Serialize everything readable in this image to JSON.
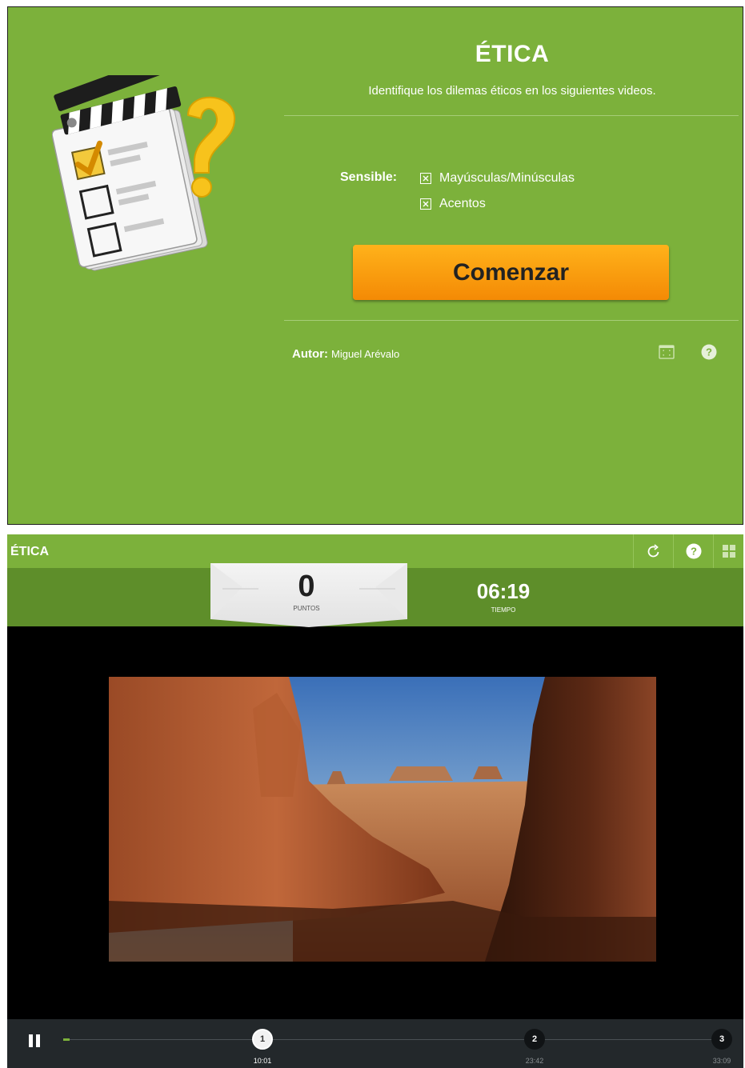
{
  "intro": {
    "title": "ÉTICA",
    "subtitle": "Identifique los dilemas éticos en los siguientes videos.",
    "sensible_label": "Sensible:",
    "options": [
      {
        "label": "Mayúsculas/Minúsculas",
        "checked": true
      },
      {
        "label": "Acentos",
        "checked": true
      }
    ],
    "start_button": "Comenzar",
    "author_label": "Autor:",
    "author_name": "Miguel Arévalo",
    "icons": [
      "quiz-clapperboard-illustration",
      "fullscreen-icon",
      "help-icon"
    ]
  },
  "game": {
    "title": "ÉTICA",
    "toolbar_icons": [
      "restart-icon",
      "help-icon",
      "grid-icon"
    ],
    "score": "0",
    "score_label": "PUNTOS",
    "time": "06:19",
    "time_label": "TIEMPO",
    "video": {
      "description": "desert canyon scene"
    },
    "progress": 0.01,
    "markers": [
      {
        "number": "1",
        "time": "10:01",
        "active": true
      },
      {
        "number": "2",
        "time": "23:42",
        "active": false
      },
      {
        "number": "3",
        "time": "33:09",
        "active": false
      }
    ]
  },
  "colors": {
    "panel_green": "#7cb13b",
    "dark_green": "#5e8e2a",
    "button_orange": "#f7920b",
    "controls_bg": "#23282b"
  }
}
